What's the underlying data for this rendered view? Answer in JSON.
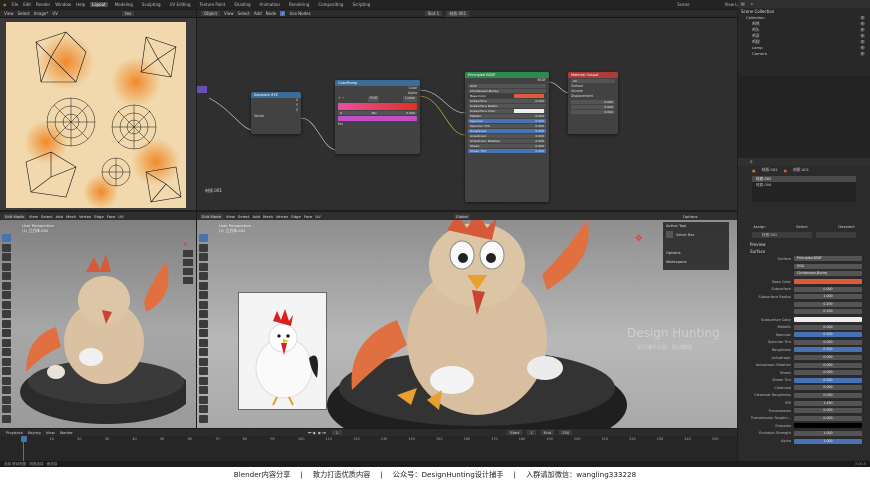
{
  "topbar": {
    "menus": [
      "File",
      "Edit",
      "Render",
      "Window",
      "Help"
    ],
    "workspaces": [
      "Layout",
      "Modeling",
      "Sculpting",
      "UV Editing",
      "Texture Paint",
      "Shading",
      "Animation",
      "Rendering",
      "Compositing",
      "Scripting"
    ],
    "active_workspace": "Layout",
    "scene": "Scene",
    "view_layer": "View Layer"
  },
  "uv_editor": {
    "menus": [
      "View",
      "Select",
      "Image*",
      "UV"
    ],
    "image_name": "tex"
  },
  "node_editor": {
    "object_mode": "Object",
    "menus": [
      "View",
      "Select",
      "Add",
      "Node"
    ],
    "use_nodes": "Use Nodes",
    "slot": "Slot 1",
    "material": "材质.001",
    "side_label": "材质.001",
    "nodes": {
      "separate": {
        "title": "Separate XYZ",
        "rows": [
          "X",
          "Y",
          "Z",
          "Vector"
        ]
      },
      "ramp": {
        "title": "ColorRamp",
        "outputs": [
          "Color",
          "Alpha"
        ],
        "mode": "RGB",
        "interp": "Linear",
        "pos_label": "0",
        "pos_field": "Pos",
        "pos_value": "0.000",
        "input": "Fac"
      },
      "bsdf": {
        "title": "Principled BSDF",
        "output": "BSDF",
        "dist": "GGX",
        "sss_method": "Christensen-Burley",
        "rows": [
          {
            "label": "Base Color",
            "value": ""
          },
          {
            "label": "Subsurface",
            "value": "0.000"
          },
          {
            "label": "Subsurface Radius",
            "value": ""
          },
          {
            "label": "Subsurface Color",
            "value": ""
          },
          {
            "label": "Metallic",
            "value": "0.000"
          },
          {
            "label": "Specular",
            "value": "0.500"
          },
          {
            "label": "Specular Tint",
            "value": "0.000"
          },
          {
            "label": "Roughness",
            "value": "0.500"
          },
          {
            "label": "Anisotropic",
            "value": "0.000"
          },
          {
            "label": "Anisotropic Rotation",
            "value": "0.000"
          },
          {
            "label": "Sheen",
            "value": "0.000"
          },
          {
            "label": "Sheen Tint",
            "value": "0.500"
          }
        ]
      },
      "output": {
        "title": "Material Output",
        "target": "All",
        "rows": [
          "Surface",
          "Volume",
          "Displacement"
        ],
        "values": [
          "0.000",
          "0.000",
          "0.000"
        ]
      }
    }
  },
  "outliner": {
    "title": "Scene Collection",
    "items": [
      "Collection",
      "鸡鸡",
      "鸡头",
      "鸡身",
      "鸡翅",
      "Lamp",
      "Camera"
    ]
  },
  "properties": {
    "object": "材质.002",
    "slot_label": "材质.001",
    "slots": [
      "材质.001",
      "材质.004"
    ],
    "tabs": [
      "Assign",
      "Select",
      "Deselect"
    ],
    "material_field": "材质.001",
    "sections": [
      "Preview",
      "Surface"
    ],
    "surface_label": "Surface",
    "surface_value": "Principled BSDF",
    "dist": "GGX",
    "sss_method": "Christensen-Burley",
    "rows": [
      {
        "label": "Base Color",
        "value": "",
        "kind": "color-red"
      },
      {
        "label": "Subsurface",
        "value": "0.000",
        "kind": "field"
      },
      {
        "label": "Subsurface Radius",
        "value": "1.000",
        "kind": "field"
      },
      {
        "label": "",
        "value": "0.200",
        "kind": "field"
      },
      {
        "label": "",
        "value": "0.100",
        "kind": "field"
      },
      {
        "label": "Subsurface Color",
        "value": "",
        "kind": "color-white"
      },
      {
        "label": "Metallic",
        "value": "0.000",
        "kind": "field"
      },
      {
        "label": "Specular",
        "value": "0.500",
        "kind": "blue"
      },
      {
        "label": "Specular Tint",
        "value": "0.000",
        "kind": "field"
      },
      {
        "label": "Roughness",
        "value": "0.500",
        "kind": "blue"
      },
      {
        "label": "Anisotropic",
        "value": "0.000",
        "kind": "field"
      },
      {
        "label": "Anisotropic Rotation",
        "value": "0.000",
        "kind": "field"
      },
      {
        "label": "Sheen",
        "value": "0.000",
        "kind": "field"
      },
      {
        "label": "Sheen Tint",
        "value": "0.500",
        "kind": "blue"
      },
      {
        "label": "Clearcoat",
        "value": "0.000",
        "kind": "field"
      },
      {
        "label": "Clearcoat Roughness",
        "value": "0.030",
        "kind": "field"
      },
      {
        "label": "IOR",
        "value": "1.450",
        "kind": "field"
      },
      {
        "label": "Transmission",
        "value": "0.000",
        "kind": "field"
      },
      {
        "label": "Transmission Roughn...",
        "value": "0.000",
        "kind": "field"
      },
      {
        "label": "Emission",
        "value": "",
        "kind": "color-black"
      },
      {
        "label": "Emission Strength",
        "value": "1.000",
        "kind": "field"
      },
      {
        "label": "Alpha",
        "value": "1.000",
        "kind": "blue"
      }
    ]
  },
  "viewport_left": {
    "mode": "Edit Mode",
    "menus": [
      "View",
      "Select",
      "Add",
      "Mesh",
      "Vertex",
      "Edge",
      "Face",
      "UV"
    ],
    "persp": "User Perspective",
    "object": "(1) 立方体.002"
  },
  "viewport_right": {
    "mode": "Edit Mode",
    "menus": [
      "View",
      "Select",
      "Add",
      "Mesh",
      "Vertex",
      "Edge",
      "Face",
      "UV"
    ],
    "persp": "User Perspective",
    "object": "(1) 立方体.002",
    "global": "Global",
    "options": "Options",
    "panel_title": "Active Tool",
    "panel_tool": "Select Box",
    "panel_sections": [
      "Options",
      "Workspace"
    ],
    "watermark": "Design Hunting",
    "watermark_sub": "设计捕手出品 · 原创教程"
  },
  "timeline": {
    "menus": [
      "Playback",
      "Keying",
      "View",
      "Marker"
    ],
    "start_label": "Start",
    "start": "1",
    "end_label": "End",
    "end": "250",
    "frame": "1",
    "ticks": [
      "0",
      "10",
      "20",
      "30",
      "40",
      "50",
      "60",
      "70",
      "80",
      "90",
      "100",
      "110",
      "120",
      "130",
      "140",
      "150",
      "160",
      "170",
      "180",
      "190",
      "200",
      "210",
      "220",
      "230",
      "240",
      "250"
    ]
  },
  "status": {
    "left": "选择 移动视图 · 网格选择 · 面选择",
    "right": "3.00.0"
  },
  "footer": {
    "items": [
      "Blender内容分享",
      "致力打造优质内容",
      "公众号：DesignHunting设计捕手",
      "入群请加微信：wangling333228"
    ],
    "sep": "|"
  },
  "colors": {
    "accent": "#4772b3",
    "bsdf_header": "#2f8a4d",
    "output_header": "#b03a3a",
    "ramp_header": "#3b6d99",
    "sep_header": "#3b6d99",
    "base_red": "#e05a3a"
  }
}
